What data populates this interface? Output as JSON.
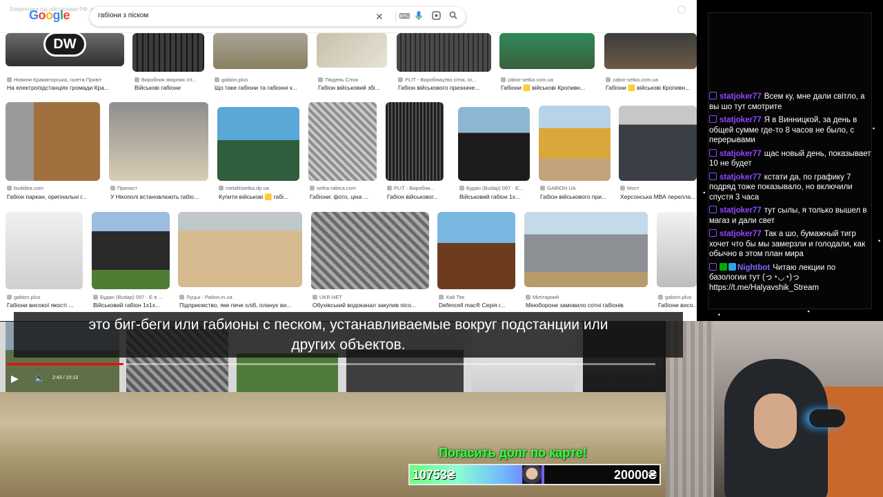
{
  "overlay": {
    "video_title": "Енергетики під обстрілами РФ: як захищають критичні об'єкти і що буде взимку | DW Ukrainian",
    "dw_logo": "DW"
  },
  "google": {
    "logo_letters": [
      "G",
      "o",
      "o",
      "g",
      "l",
      "e"
    ],
    "search_value": "габіони з піском",
    "icons": [
      "close-icon",
      "keyboard-icon",
      "mic-icon",
      "lens-icon",
      "search-icon"
    ]
  },
  "image_rows": [
    [
      {
        "source": "Новини Краматорська, газета Привіт",
        "caption": "На електропідстанціях громади Кра..."
      },
      {
        "source": "Виробник зварних сіт...",
        "caption": "Військові габіони"
      },
      {
        "source": "gabion.plus",
        "caption": "Що таке габіони та габіонні к..."
      },
      {
        "source": "Південь Сітка",
        "caption": "Габіон військовий збі..."
      },
      {
        "source": "PLIT - Виробництво сіток, ог...",
        "caption": "Габіон військового призначе..."
      },
      {
        "source": "zabor-setka.com.ua",
        "caption": "Габіони 🟨 військові Кропивн..."
      },
      {
        "source": "zabor-setka.com.ua",
        "caption": "Габіони 🟨 військові Кропивн..."
      }
    ],
    [
      {
        "source": "budidea.com",
        "caption": "Габіон паркан, оригінальні г..."
      },
      {
        "source": "Прихист",
        "caption": "У Нікополі встановлюють габіо..."
      },
      {
        "source": "metallosetka.dp.ua",
        "caption": "Купити військові 🟨 габі..."
      },
      {
        "source": "setka-rabica.com",
        "caption": "Габіони: фото, ціна ..."
      },
      {
        "source": "PLIT - Виробни...",
        "caption": "Габіон військовог..."
      },
      {
        "source": "Будан (Budap) 097 · Є...",
        "caption": "Військовий габіон 1х..."
      },
      {
        "source": "GABION UA",
        "caption": "Габіон військового при..."
      },
      {
        "source": "Мост",
        "caption": "Херсонська МВА перепла..."
      }
    ],
    [
      {
        "source": "gabion.plus",
        "caption": "Габіони високої якості ..."
      },
      {
        "source": "Будан (Budap) 097 · Є в ...",
        "caption": "Військовий габіон 1х1х..."
      },
      {
        "source": "Луцьк - Район.in.ua",
        "caption": "Підприємство, яке пече хліб, планує ви..."
      },
      {
        "source": "UKR.NET",
        "caption": "Обухівський водоканал закупив пісо..."
      },
      {
        "source": "Хай Тек",
        "caption": "Defencell mac® Серія г..."
      },
      {
        "source": "Мілітарний",
        "caption": "Міноборони замовило сотні габіонів"
      },
      {
        "source": "gabion.plus",
        "caption": "Габіони висо..."
      }
    ]
  ],
  "subtitles": {
    "line1": "это биг-беги или габионы с песком, устанавливаемые вокруг подстанции или",
    "line2": "других объектов."
  },
  "player": {
    "time": "2:43 / 15:13",
    "progress_fraction": 0.18
  },
  "chat": {
    "messages": [
      {
        "user": "statjoker77",
        "text": "Всем ку, мне дали світло, а вы шо тут смотрите",
        "color": "#9147ff"
      },
      {
        "user": "statjoker77",
        "text": "Я в Винницкой, за день в общей сумме где-то 8 часов не было, с перерывами",
        "color": "#9147ff"
      },
      {
        "user": "statjoker77",
        "text": "щас новый день, показывает 10 не будет",
        "color": "#9147ff"
      },
      {
        "user": "statjoker77",
        "text": "кстати да, по графику 7 подряд тоже показывало, но включили спустя 3 часа",
        "color": "#9147ff"
      },
      {
        "user": "statjoker77",
        "text": "тут сылы, я только вышел в магаз и дали свет",
        "color": "#9147ff"
      },
      {
        "user": "statjoker77",
        "text": "Так а шо, бумажный тигр хочет что бы мы замерзли и голодали, как обычно в этом план мира",
        "color": "#9147ff"
      },
      {
        "user": "Nightbot",
        "text": "Читаю лекции по базологии тут (っ◔◡◔)っ https://t.me/Halyavshik_Stream",
        "color": "#7b6bff"
      }
    ]
  },
  "donation": {
    "label": "Погасить долг по карте!",
    "current": "10753₴",
    "goal": "20000₴",
    "progress_fraction": 0.54
  }
}
